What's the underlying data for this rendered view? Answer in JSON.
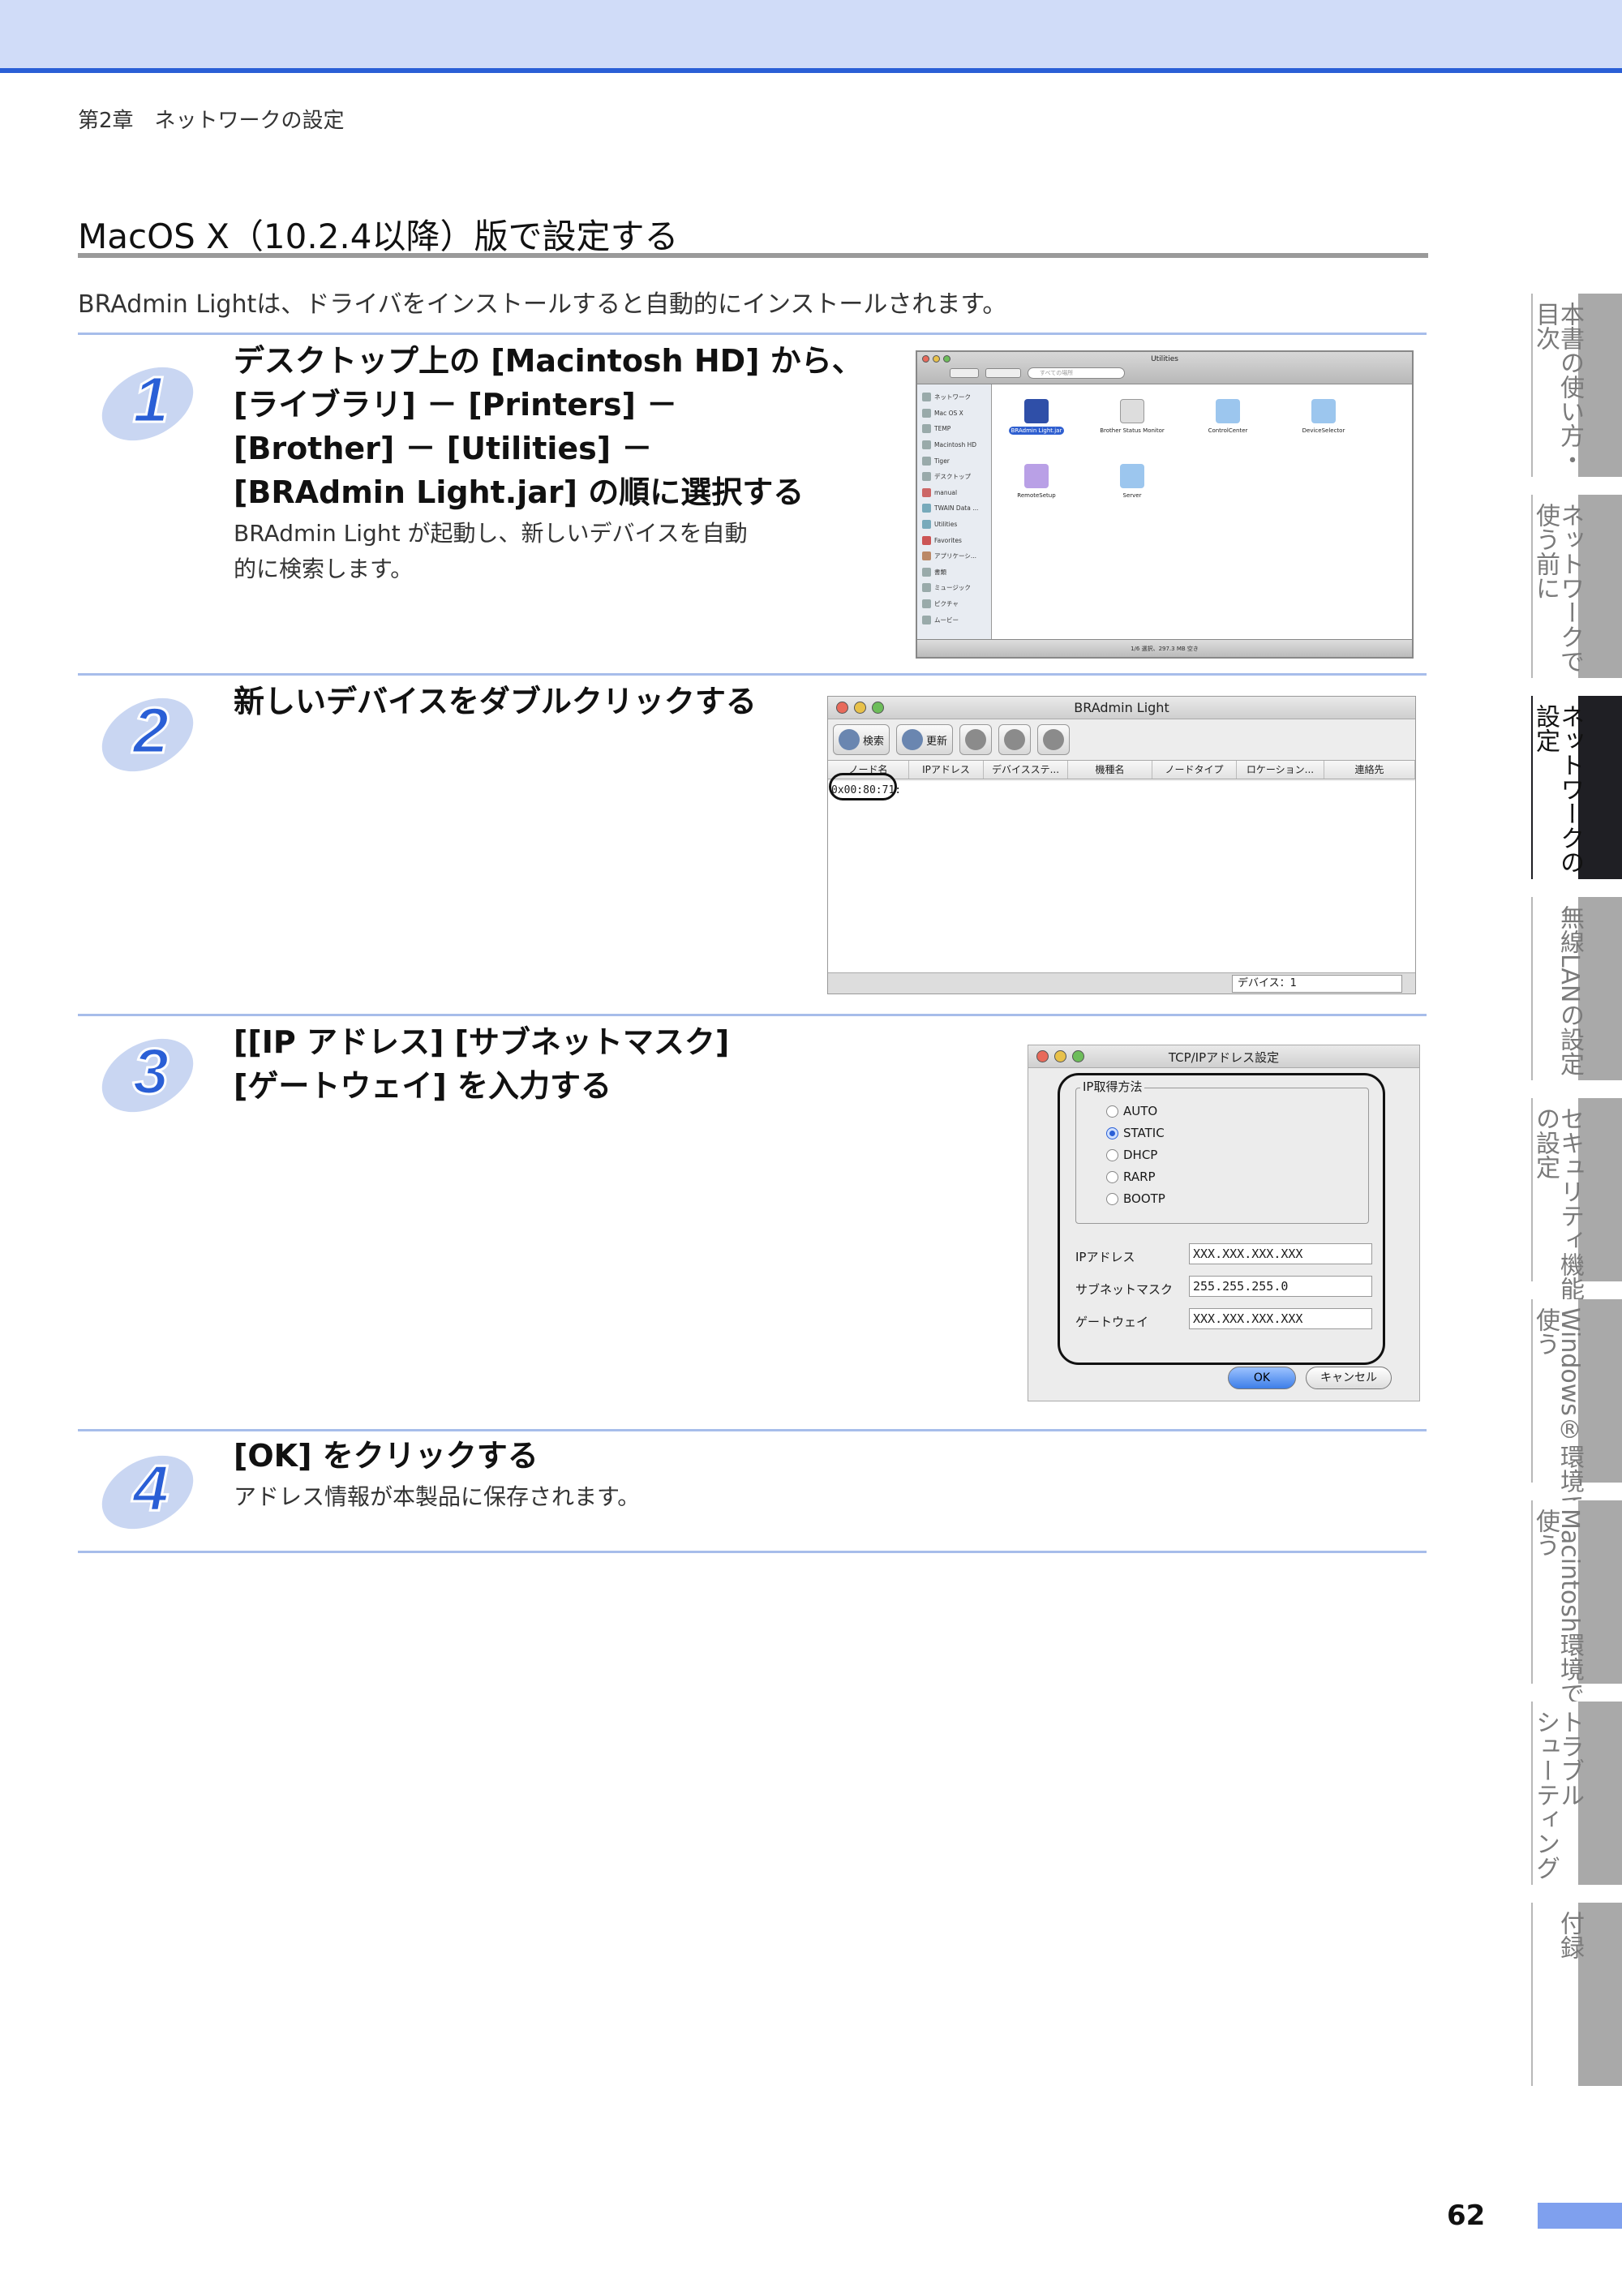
{
  "header": {
    "chapter": "第2章　ネットワークの設定"
  },
  "section": {
    "title": "MacOS X（10.2.4以降）版で設定する",
    "intro": "BRAdmin Lightは、ドライバをインストールすると自動的にインストールされます。"
  },
  "steps": [
    {
      "number": "1",
      "title_lines": [
        "デスクトップ上の [Macintosh HD] から、",
        "[ライブラリ] － [Printers] －",
        "[Brother] － [Utilities] －",
        "[BRAdmin Light.jar] の順に選択する"
      ],
      "desc_lines": [
        "BRAdmin Light が起動し、新しいデバイスを自動",
        "的に検索します。"
      ]
    },
    {
      "number": "2",
      "title_lines": [
        "新しいデバイスをダブルクリックする"
      ]
    },
    {
      "number": "3",
      "title_lines": [
        "[[IP アドレス] [サブネットマスク]",
        "[ゲートウェイ] を入力する"
      ]
    },
    {
      "number": "4",
      "title_lines": [
        "[OK] をクリックする"
      ],
      "desc_lines": [
        "アドレス情報が本製品に保存されます。"
      ]
    }
  ],
  "finder": {
    "title": "Utilities",
    "search_placeholder": "すべての場所",
    "sidebar": [
      "ネットワーク",
      "Mac OS X",
      "TEMP",
      "Macintosh HD",
      "Tiger",
      "デスクトップ",
      "manual",
      "TWAIN Data ...",
      "Utilities",
      "Favorites",
      "アプリケーシ...",
      "書類",
      "ミュージック",
      "ピクチャ",
      "ムービー"
    ],
    "items": [
      {
        "label": "BRAdmin Light.jar",
        "selected": true
      },
      {
        "label": "Brother Status Monitor",
        "selected": false
      },
      {
        "label": "ControlCenter",
        "selected": false
      },
      {
        "label": "DeviceSelector",
        "selected": false
      },
      {
        "label": "RemoteSetup",
        "selected": false
      },
      {
        "label": "Server",
        "selected": false
      }
    ],
    "status": "1/6 選択、297.3 MB 空き"
  },
  "bradmin": {
    "title": "BRAdmin Light",
    "search_label": "検索",
    "refresh_label": "更新",
    "columns": [
      "ノード名",
      "IPアドレス",
      "デバイスステ...",
      "機種名",
      "ノードタイプ",
      "ロケーション...",
      "連絡先"
    ],
    "row": "0x00:80:71:",
    "device_count": "デバイス：1"
  },
  "tcpip": {
    "title": "TCP/IPアドレス設定",
    "group_label": "IP取得方法",
    "methods": [
      {
        "label": "AUTO",
        "selected": false
      },
      {
        "label": "STATIC",
        "selected": true
      },
      {
        "label": "DHCP",
        "selected": false
      },
      {
        "label": "RARP",
        "selected": false
      },
      {
        "label": "BOOTP",
        "selected": false
      }
    ],
    "fields": [
      {
        "label": "IPアドレス",
        "value": "XXX.XXX.XXX.XXX"
      },
      {
        "label": "サブネットマスク",
        "value": "255.255.255.0"
      },
      {
        "label": "ゲートウェイ",
        "value": "XXX.XXX.XXX.XXX"
      }
    ],
    "ok_label": "OK",
    "cancel_label": "キャンセル"
  },
  "side_tabs": [
    {
      "line1": "本書の使い方・",
      "line2": "目次",
      "active": false
    },
    {
      "line1": "ネットワークで",
      "line2": "使う前に",
      "active": false
    },
    {
      "line1": "ネットワークの",
      "line2": "設定",
      "active": true
    },
    {
      "line1": "無線LANの設定",
      "line2": "",
      "active": false
    },
    {
      "line1": "セキュリティ機能",
      "line2": "の設定",
      "active": false
    },
    {
      "line1": "Windows®環境で",
      "line2": "使う",
      "active": false
    },
    {
      "line1": "Macintosh環境で",
      "line2": "使う",
      "active": false
    },
    {
      "line1": "トラブル",
      "line2": "シューティング",
      "active": false
    },
    {
      "line1": "付録",
      "line2": "",
      "active": false
    }
  ],
  "page_number": "62",
  "colors": {
    "accent": "#2a5fd6",
    "band": "#d0dcf8",
    "step_rule": "#a7bdea",
    "active_tab": "#1f1f24"
  }
}
